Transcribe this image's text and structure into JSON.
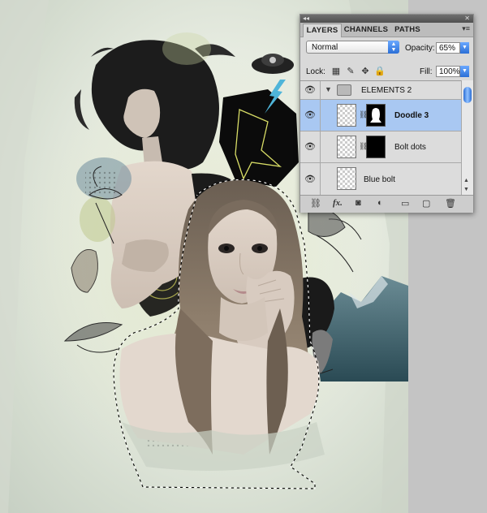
{
  "app": "Photoshop",
  "layers_panel": {
    "tabs": [
      {
        "label": "LAYERS",
        "active": true
      },
      {
        "label": "CHANNELS",
        "active": false
      },
      {
        "label": "PATHS",
        "active": false
      }
    ],
    "blend_mode": "Normal",
    "opacity_label": "Opacity:",
    "opacity_value": "65%",
    "lock_label": "Lock:",
    "fill_label": "Fill:",
    "fill_value": "100%",
    "layers": [
      {
        "name": "ELEMENTS 2",
        "type": "group",
        "selected": false
      },
      {
        "name": "Doodle 3",
        "type": "layer-with-mask",
        "selected": true,
        "mask": "white-silhouette"
      },
      {
        "name": "Bolt dots",
        "type": "layer-with-mask",
        "selected": false,
        "mask": "black"
      },
      {
        "name": "Blue bolt",
        "type": "layer",
        "selected": false
      }
    ],
    "bottom_icons": [
      "link-icon",
      "fx-icon",
      "add-mask-icon",
      "adjustment-icon",
      "group-icon",
      "new-layer-icon",
      "trash-icon"
    ],
    "fx_label": "fx."
  },
  "canvas": {
    "background": "#e6ebe0",
    "selection": "marching-ants around foreground portrait"
  },
  "colors": {
    "panel_bg": "#d9d9d9",
    "selected_row": "#a9c8f2",
    "accent_blue": "#2b6fd6"
  }
}
